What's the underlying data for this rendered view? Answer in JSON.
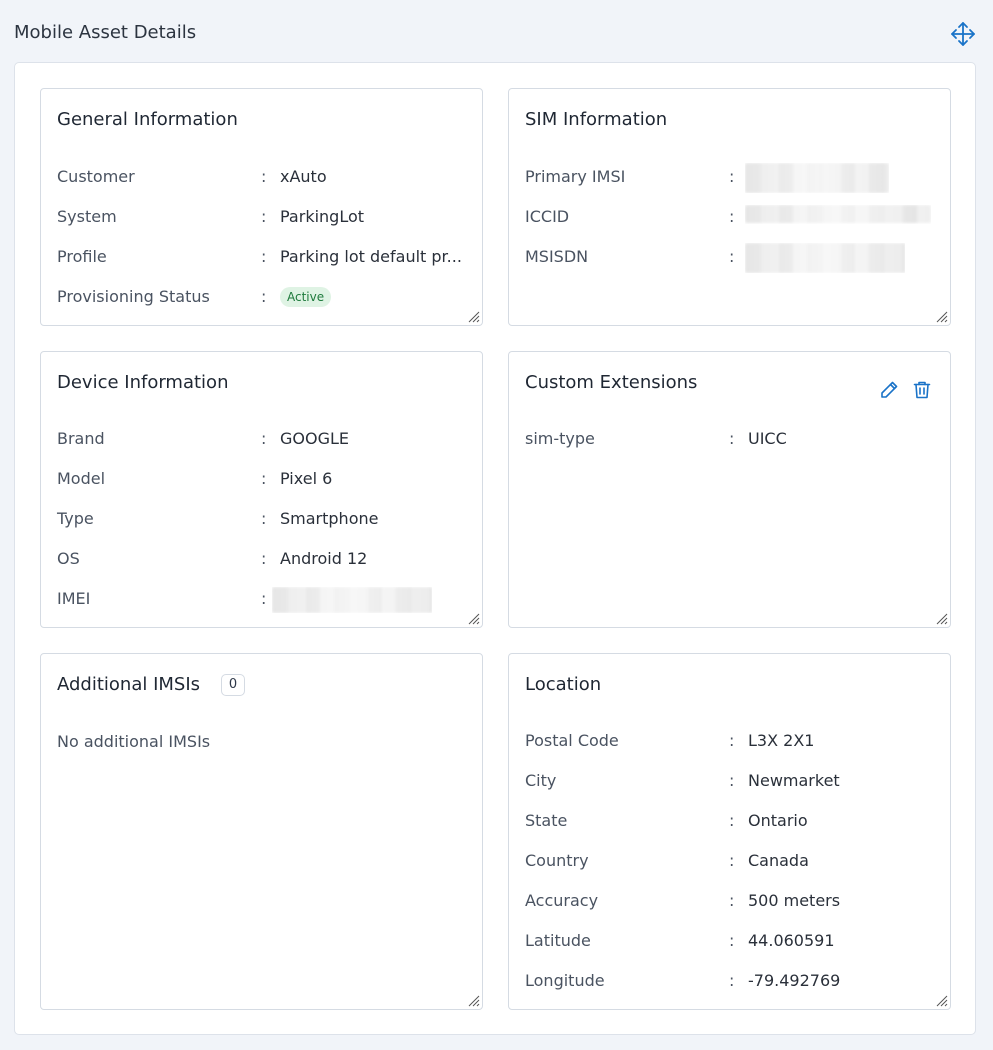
{
  "page": {
    "title": "Mobile Asset Details"
  },
  "general": {
    "title": "General Information",
    "rows": [
      {
        "label": "Customer",
        "value": "xAuto"
      },
      {
        "label": "System",
        "value": "ParkingLot"
      },
      {
        "label": "Profile",
        "value": "Parking lot default pr..."
      },
      {
        "label": "Provisioning Status",
        "value": "Active"
      }
    ]
  },
  "sim": {
    "title": "SIM Information",
    "rows": [
      {
        "label": "Primary IMSI"
      },
      {
        "label": "ICCID"
      },
      {
        "label": "MSISDN"
      }
    ]
  },
  "device": {
    "title": "Device Information",
    "rows": [
      {
        "label": "Brand",
        "value": "GOOGLE"
      },
      {
        "label": "Model",
        "value": "Pixel 6"
      },
      {
        "label": "Type",
        "value": "Smartphone"
      },
      {
        "label": "OS",
        "value": "Android 12"
      },
      {
        "label": "IMEI"
      }
    ]
  },
  "custom": {
    "title": "Custom Extensions",
    "rows": [
      {
        "label": "sim-type",
        "value": "UICC"
      }
    ]
  },
  "imsis": {
    "title": "Additional IMSIs",
    "count": "0",
    "empty_text": "No additional IMSIs"
  },
  "location": {
    "title": "Location",
    "rows": [
      {
        "label": "Postal Code",
        "value": "L3X 2X1"
      },
      {
        "label": "City",
        "value": "Newmarket"
      },
      {
        "label": "State",
        "value": "Ontario"
      },
      {
        "label": "Country",
        "value": "Canada"
      },
      {
        "label": "Accuracy",
        "value": "500 meters"
      },
      {
        "label": "Latitude",
        "value": "44.060591"
      },
      {
        "label": "Longitude",
        "value": "-79.492769"
      }
    ]
  },
  "separator": ":",
  "colors": {
    "accent": "#1a73c8",
    "badge_bg": "#dff3e4",
    "badge_text": "#1e7a3c"
  },
  "icons": {
    "move": "move-icon",
    "edit": "pencil-icon",
    "delete": "trash-icon",
    "resize": "resize-grip-icon"
  }
}
